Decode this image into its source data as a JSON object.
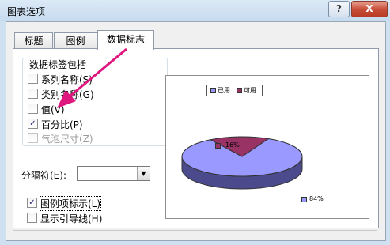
{
  "window": {
    "title": "图表选项",
    "help_label": "?",
    "close_label": "X"
  },
  "tabs": [
    {
      "label": "标题"
    },
    {
      "label": "图例"
    },
    {
      "label": "数据标志",
      "active": true
    }
  ],
  "label_group": {
    "title": "数据标签包括",
    "items": [
      {
        "label": "系列名称(S)",
        "checked": false,
        "enabled": true
      },
      {
        "label": "类别名称(G)",
        "checked": false,
        "enabled": true
      },
      {
        "label": "值(V)",
        "checked": false,
        "enabled": true
      },
      {
        "label": "百分比(P)",
        "checked": true,
        "enabled": true
      },
      {
        "label": "气泡尺寸(Z)",
        "checked": false,
        "enabled": false
      }
    ]
  },
  "separator": {
    "label": "分隔符(E):",
    "value": ""
  },
  "legend_key": {
    "label": "图例项标示(L)",
    "checked": true
  },
  "leader_lines": {
    "label": "显示引导线(H)",
    "checked": false
  },
  "check_mark": "✓",
  "dropdown_arrow": "▼",
  "annotation_arrow_color": "#e0167f",
  "chart_data": {
    "type": "pie",
    "categories": [
      "已用",
      "可用"
    ],
    "values": [
      84,
      16
    ],
    "labels": [
      "84%",
      "16%"
    ],
    "colors": [
      "#9999ff",
      "#993366"
    ],
    "legend_position": "top"
  }
}
